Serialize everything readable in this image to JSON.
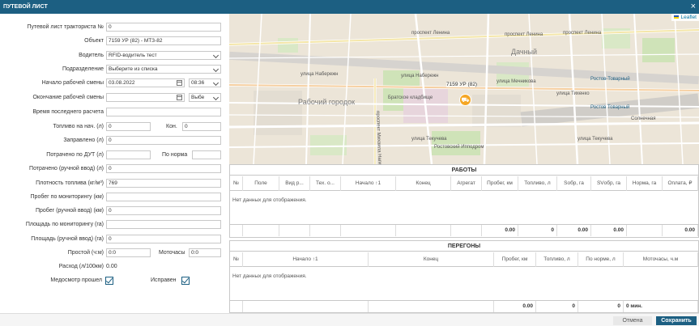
{
  "window": {
    "title": "ПУТЕВОЙ ЛИСТ",
    "close_icon": "close-icon"
  },
  "form": {
    "waybill_no": {
      "label": "Путевой лист тракториста №",
      "value": "0"
    },
    "object": {
      "label": "Объект",
      "value": "7159 УР (82) - МТЗ-82"
    },
    "driver": {
      "label": "Водитель",
      "value": "RFID-водитель тест"
    },
    "department": {
      "label": "Подразделение",
      "value": "Выберите из списка"
    },
    "shift_start": {
      "label": "Начало рабочей смены",
      "date": "03.08.2022",
      "time": "08:36"
    },
    "shift_end": {
      "label": "Окончание рабочей смены",
      "date": "",
      "time": "Выбе"
    },
    "last_calc": {
      "label": "Время последнего расчета",
      "value": ""
    },
    "fuel_start": {
      "label": "Топливо на нач. (л)",
      "value": "0",
      "end_label": "Кон.",
      "end_value": "0"
    },
    "refueled": {
      "label": "Заправлено (л)",
      "value": "0"
    },
    "consumed_dut": {
      "label": "Потрачено по ДУТ (л)",
      "value": "",
      "norm_label": "По норма",
      "norm_value": ""
    },
    "consumed_manual": {
      "label": "Потрачено (ручной ввод) (л)",
      "value": "0"
    },
    "fuel_density": {
      "label": "Плотность топлива (кг/м³)",
      "value": "769"
    },
    "mileage_mon": {
      "label": "Пробег по мониторингу (км)",
      "value": ""
    },
    "mileage_manual": {
      "label": "Пробег (ручной ввод) (км)",
      "value": "0"
    },
    "area_mon": {
      "label": "Площадь по мониторингу (га)",
      "value": ""
    },
    "area_manual": {
      "label": "Площадь (ручной ввод) (га)",
      "value": "0"
    },
    "idle": {
      "label": "Простой (ч:м)",
      "value": "0:0",
      "moto_label": "Моточасы",
      "moto_value": "0:0"
    },
    "consumption": {
      "label": "Расход (л/100км)",
      "value": "0.00"
    },
    "medical": {
      "label": "Медосмотр прошел",
      "checked": true
    },
    "serviceable": {
      "label": "Исправен",
      "checked": true
    }
  },
  "map": {
    "attribution": "Leaflet",
    "district_labels": [
      "Рабочий городок",
      "Дачный"
    ],
    "street_labels": [
      "проспект Ленина",
      "проспект Ленина",
      "проспект Ленина",
      "улица Набережн",
      "улица Набережн",
      "улица Мечникова",
      "улица Тихенко",
      "проспект Михаила Нагибина",
      "Братское кладбище",
      "Ростовский Ипподром",
      "улица Текучева",
      "Ростов-Товарный",
      "Ростов Товарный",
      "Солнечная",
      "улица Текучева"
    ],
    "marker_label": "7159 УР (82)",
    "marker_icon": "tractor-icon"
  },
  "works": {
    "caption": "РАБОТЫ",
    "columns": [
      "№",
      "Поле",
      "Вид р...",
      "Тех. о...",
      "Начало ↑1",
      "Конец",
      "Агрегат",
      "Пробег, км",
      "Топливо, л",
      "Sобр, га",
      "SVобр, га",
      "Норма, га",
      "Оплата, ₽"
    ],
    "empty_text": "Нет данных для отображения.",
    "totals": [
      "",
      "",
      "",
      "",
      "",
      "",
      "",
      "0.00",
      "0",
      "0.00",
      "0.00",
      "",
      "0.00"
    ]
  },
  "transfers": {
    "caption": "ПЕРЕГОНЫ",
    "columns": [
      "№",
      "Начало ↑1",
      "Конец",
      "Пробег, км",
      "Топливо, л",
      "По норме, л",
      "Моточасы, ч.м"
    ],
    "empty_text": "Нет данных для отображения.",
    "totals": [
      "",
      "",
      "",
      "0.00",
      "0",
      "0",
      "0 мин."
    ]
  },
  "footer": {
    "cancel": "Отмена",
    "save": "Сохранить"
  },
  "colors": {
    "accent": "#1c5f82",
    "marker": "#f5a623"
  }
}
